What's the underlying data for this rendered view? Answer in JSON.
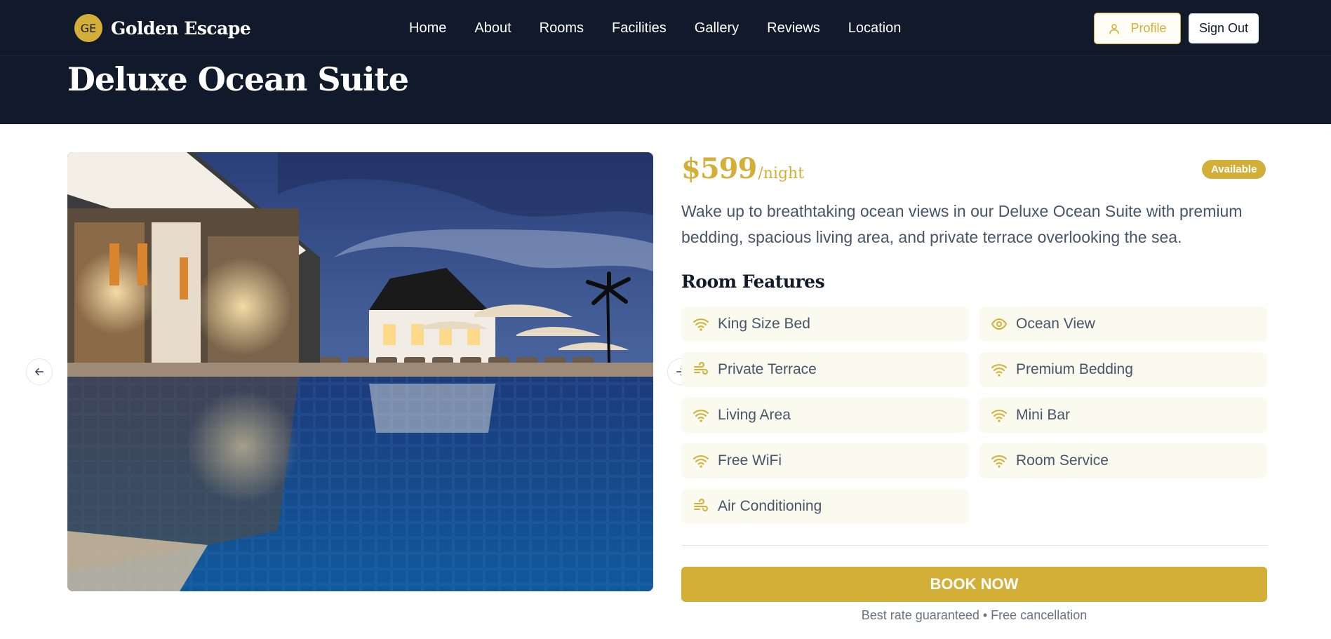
{
  "brand": {
    "initials": "GE",
    "name": "Golden Escape"
  },
  "nav": {
    "links": [
      "Home",
      "About",
      "Rooms",
      "Facilities",
      "Gallery",
      "Reviews",
      "Location"
    ],
    "profile_label": "Profile",
    "signout_label": "Sign Out"
  },
  "room": {
    "title": "Deluxe Ocean Suite",
    "price": "$599",
    "price_unit": "/night",
    "status": "Available",
    "description": "Wake up to breathtaking ocean views in our Deluxe Ocean Suite with premium bedding, spacious living area, and private terrace overlooking the sea.",
    "features_title": "Room Features",
    "features": [
      {
        "label": "King Size Bed",
        "icon": "wifi-icon"
      },
      {
        "label": "Ocean View",
        "icon": "eye-icon"
      },
      {
        "label": "Private Terrace",
        "icon": "wind-icon"
      },
      {
        "label": "Premium Bedding",
        "icon": "wifi-icon"
      },
      {
        "label": "Living Area",
        "icon": "wifi-icon"
      },
      {
        "label": "Mini Bar",
        "icon": "wifi-icon"
      },
      {
        "label": "Free WiFi",
        "icon": "wifi-icon"
      },
      {
        "label": "Room Service",
        "icon": "wifi-icon"
      },
      {
        "label": "Air Conditioning",
        "icon": "wind-icon"
      }
    ],
    "book_label": "BOOK NOW",
    "book_note": "Best rate guaranteed • Free cancellation"
  },
  "colors": {
    "navy": "#111a2b",
    "gold": "#d4af37",
    "feature_bg": "#fafaee"
  }
}
